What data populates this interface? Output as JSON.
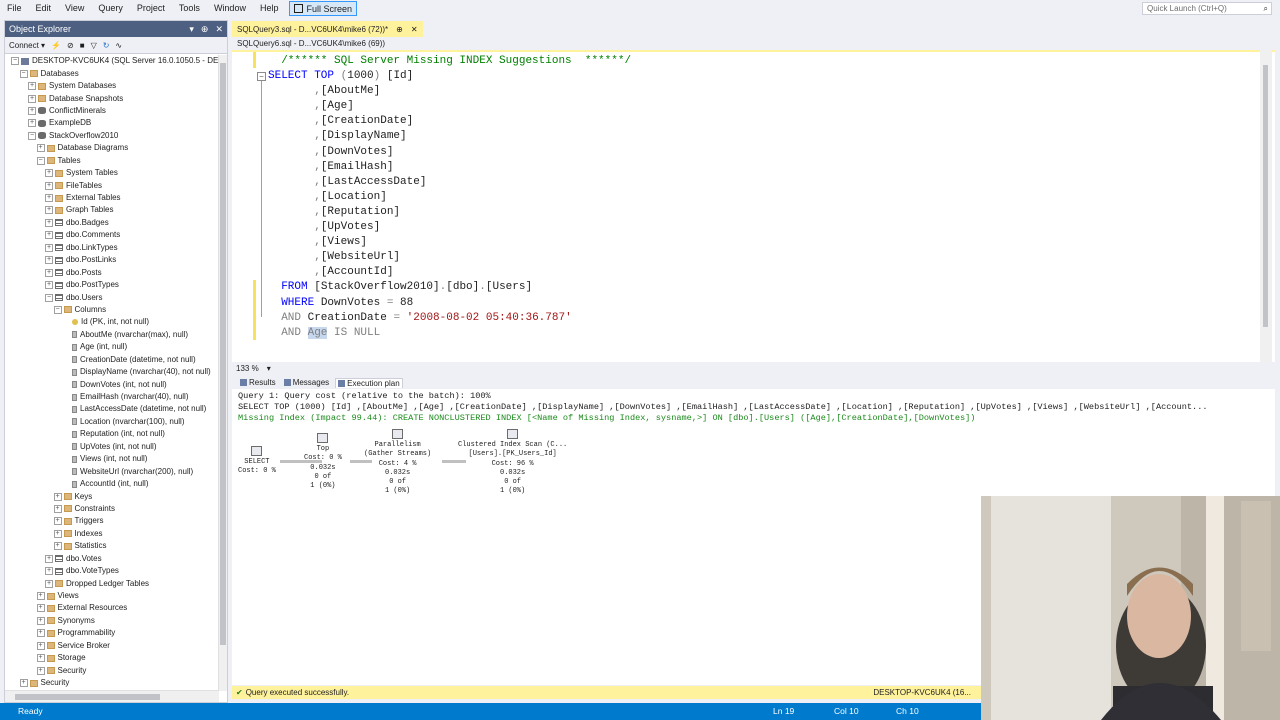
{
  "menubar": {
    "items": [
      "File",
      "Edit",
      "View",
      "Query",
      "Project",
      "Tools",
      "Window",
      "Help"
    ],
    "fullscreen_label": "Full Screen",
    "quick_launch_placeholder": "Quick Launch (Ctrl+Q)"
  },
  "object_explorer": {
    "title": "Object Explorer",
    "connect_label": "Connect ▾",
    "tree": [
      {
        "label": "DESKTOP-KVC6UK4 (SQL Server 16.0.1050.5 - DESKTO",
        "indent": 0,
        "expander": "−",
        "icon": "server"
      },
      {
        "label": "Databases",
        "indent": 1,
        "expander": "−",
        "icon": "folder"
      },
      {
        "label": "System Databases",
        "indent": 2,
        "expander": "+",
        "icon": "folder"
      },
      {
        "label": "Database Snapshots",
        "indent": 2,
        "expander": "+",
        "icon": "folder"
      },
      {
        "label": "ConflictMinerals",
        "indent": 2,
        "expander": "+",
        "icon": "db"
      },
      {
        "label": "ExampleDB",
        "indent": 2,
        "expander": "+",
        "icon": "db"
      },
      {
        "label": "StackOverflow2010",
        "indent": 2,
        "expander": "−",
        "icon": "db"
      },
      {
        "label": "Database Diagrams",
        "indent": 3,
        "expander": "+",
        "icon": "folder"
      },
      {
        "label": "Tables",
        "indent": 3,
        "expander": "−",
        "icon": "folder"
      },
      {
        "label": "System Tables",
        "indent": 4,
        "expander": "+",
        "icon": "folder"
      },
      {
        "label": "FileTables",
        "indent": 4,
        "expander": "+",
        "icon": "folder"
      },
      {
        "label": "External Tables",
        "indent": 4,
        "expander": "+",
        "icon": "folder"
      },
      {
        "label": "Graph Tables",
        "indent": 4,
        "expander": "+",
        "icon": "folder"
      },
      {
        "label": "dbo.Badges",
        "indent": 4,
        "expander": "+",
        "icon": "table"
      },
      {
        "label": "dbo.Comments",
        "indent": 4,
        "expander": "+",
        "icon": "table"
      },
      {
        "label": "dbo.LinkTypes",
        "indent": 4,
        "expander": "+",
        "icon": "table"
      },
      {
        "label": "dbo.PostLinks",
        "indent": 4,
        "expander": "+",
        "icon": "table"
      },
      {
        "label": "dbo.Posts",
        "indent": 4,
        "expander": "+",
        "icon": "table"
      },
      {
        "label": "dbo.PostTypes",
        "indent": 4,
        "expander": "+",
        "icon": "table"
      },
      {
        "label": "dbo.Users",
        "indent": 4,
        "expander": "−",
        "icon": "table"
      },
      {
        "label": "Columns",
        "indent": 5,
        "expander": "−",
        "icon": "folder"
      },
      {
        "label": "Id (PK, int, not null)",
        "indent": 6,
        "expander": "",
        "icon": "key"
      },
      {
        "label": "AboutMe (nvarchar(max), null)",
        "indent": 6,
        "expander": "",
        "icon": "col"
      },
      {
        "label": "Age (int, null)",
        "indent": 6,
        "expander": "",
        "icon": "col"
      },
      {
        "label": "CreationDate (datetime, not null)",
        "indent": 6,
        "expander": "",
        "icon": "col"
      },
      {
        "label": "DisplayName (nvarchar(40), not null)",
        "indent": 6,
        "expander": "",
        "icon": "col"
      },
      {
        "label": "DownVotes (int, not null)",
        "indent": 6,
        "expander": "",
        "icon": "col"
      },
      {
        "label": "EmailHash (nvarchar(40), null)",
        "indent": 6,
        "expander": "",
        "icon": "col"
      },
      {
        "label": "LastAccessDate (datetime, not null)",
        "indent": 6,
        "expander": "",
        "icon": "col"
      },
      {
        "label": "Location (nvarchar(100), null)",
        "indent": 6,
        "expander": "",
        "icon": "col"
      },
      {
        "label": "Reputation (int, not null)",
        "indent": 6,
        "expander": "",
        "icon": "col"
      },
      {
        "label": "UpVotes (int, not null)",
        "indent": 6,
        "expander": "",
        "icon": "col"
      },
      {
        "label": "Views (int, not null)",
        "indent": 6,
        "expander": "",
        "icon": "col"
      },
      {
        "label": "WebsiteUrl (nvarchar(200), null)",
        "indent": 6,
        "expander": "",
        "icon": "col"
      },
      {
        "label": "AccountId (int, null)",
        "indent": 6,
        "expander": "",
        "icon": "col"
      },
      {
        "label": "Keys",
        "indent": 5,
        "expander": "+",
        "icon": "folder"
      },
      {
        "label": "Constraints",
        "indent": 5,
        "expander": "+",
        "icon": "folder"
      },
      {
        "label": "Triggers",
        "indent": 5,
        "expander": "+",
        "icon": "folder"
      },
      {
        "label": "Indexes",
        "indent": 5,
        "expander": "+",
        "icon": "folder"
      },
      {
        "label": "Statistics",
        "indent": 5,
        "expander": "+",
        "icon": "folder"
      },
      {
        "label": "dbo.Votes",
        "indent": 4,
        "expander": "+",
        "icon": "table"
      },
      {
        "label": "dbo.VoteTypes",
        "indent": 4,
        "expander": "+",
        "icon": "table"
      },
      {
        "label": "Dropped Ledger Tables",
        "indent": 4,
        "expander": "+",
        "icon": "folder"
      },
      {
        "label": "Views",
        "indent": 3,
        "expander": "+",
        "icon": "folder"
      },
      {
        "label": "External Resources",
        "indent": 3,
        "expander": "+",
        "icon": "folder"
      },
      {
        "label": "Synonyms",
        "indent": 3,
        "expander": "+",
        "icon": "folder"
      },
      {
        "label": "Programmability",
        "indent": 3,
        "expander": "+",
        "icon": "folder"
      },
      {
        "label": "Service Broker",
        "indent": 3,
        "expander": "+",
        "icon": "folder"
      },
      {
        "label": "Storage",
        "indent": 3,
        "expander": "+",
        "icon": "folder"
      },
      {
        "label": "Security",
        "indent": 3,
        "expander": "+",
        "icon": "folder"
      },
      {
        "label": "Security",
        "indent": 1,
        "expander": "+",
        "icon": "folder"
      }
    ]
  },
  "tabs": {
    "active": "SQLQuery3.sql - D...VC6UK4\\mike6 (72))*",
    "active_pin": "⊕",
    "active_close": "✕",
    "second": "SQLQuery6.sql - D...VC6UK4\\mike6 (69))"
  },
  "editor": {
    "lines": [
      [
        {
          "t": "  /****** SQL Server Missing INDEX Suggestions  ******/",
          "c": "cm"
        }
      ],
      [
        {
          "t": "SELECT TOP ",
          "c": "kw"
        },
        {
          "t": "(",
          "c": "gr"
        },
        {
          "t": "1000",
          "c": ""
        },
        {
          "t": ")",
          "c": "gr"
        },
        {
          "t": " [Id]",
          "c": ""
        }
      ],
      [
        {
          "t": "       ,",
          "c": "gr"
        },
        {
          "t": "[AboutMe]",
          "c": ""
        }
      ],
      [
        {
          "t": "       ,",
          "c": "gr"
        },
        {
          "t": "[Age]",
          "c": ""
        }
      ],
      [
        {
          "t": "       ,",
          "c": "gr"
        },
        {
          "t": "[CreationDate]",
          "c": ""
        }
      ],
      [
        {
          "t": "       ,",
          "c": "gr"
        },
        {
          "t": "[DisplayName]",
          "c": ""
        }
      ],
      [
        {
          "t": "       ,",
          "c": "gr"
        },
        {
          "t": "[DownVotes]",
          "c": ""
        }
      ],
      [
        {
          "t": "       ,",
          "c": "gr"
        },
        {
          "t": "[EmailHash]",
          "c": ""
        }
      ],
      [
        {
          "t": "       ,",
          "c": "gr"
        },
        {
          "t": "[LastAccessDate]",
          "c": ""
        }
      ],
      [
        {
          "t": "       ,",
          "c": "gr"
        },
        {
          "t": "[Location]",
          "c": ""
        }
      ],
      [
        {
          "t": "       ,",
          "c": "gr"
        },
        {
          "t": "[Reputation]",
          "c": ""
        }
      ],
      [
        {
          "t": "       ,",
          "c": "gr"
        },
        {
          "t": "[UpVotes]",
          "c": ""
        }
      ],
      [
        {
          "t": "       ,",
          "c": "gr"
        },
        {
          "t": "[Views]",
          "c": ""
        }
      ],
      [
        {
          "t": "       ,",
          "c": "gr"
        },
        {
          "t": "[WebsiteUrl]",
          "c": ""
        }
      ],
      [
        {
          "t": "       ,",
          "c": "gr"
        },
        {
          "t": "[AccountId]",
          "c": ""
        }
      ],
      [
        {
          "t": "  FROM ",
          "c": "kw"
        },
        {
          "t": "[StackOverflow2010]",
          "c": ""
        },
        {
          "t": ".",
          "c": "gr"
        },
        {
          "t": "[dbo]",
          "c": ""
        },
        {
          "t": ".",
          "c": "gr"
        },
        {
          "t": "[Users]",
          "c": ""
        }
      ],
      [
        {
          "t": "  WHERE ",
          "c": "kw"
        },
        {
          "t": "DownVotes ",
          "c": ""
        },
        {
          "t": "=",
          "c": "gr"
        },
        {
          "t": " 88",
          "c": ""
        }
      ],
      [
        {
          "t": "  AND ",
          "c": "gr"
        },
        {
          "t": "CreationDate ",
          "c": ""
        },
        {
          "t": "=",
          "c": "gr"
        },
        {
          "t": " '2008-08-02 05:40:36.787'",
          "c": "st"
        }
      ],
      [
        {
          "t": "  AND ",
          "c": "gr"
        },
        {
          "t": "Age",
          "c": "gr hl"
        },
        {
          "t": " IS NULL",
          "c": "gr"
        }
      ]
    ],
    "zoom": "133 %",
    "zoom_caret": "▾"
  },
  "results": {
    "tabs": [
      "Results",
      "Messages",
      "Execution plan"
    ],
    "query_cost": "Query 1: Query cost (relative to the batch): 100%",
    "query_text": "SELECT TOP (1000) [Id] ,[AboutMe] ,[Age] ,[CreationDate] ,[DisplayName] ,[DownVotes] ,[EmailHash] ,[LastAccessDate] ,[Location] ,[Reputation] ,[UpVotes] ,[Views] ,[WebsiteUrl] ,[Account...",
    "missing_index": "Missing Index (Impact 99.44): CREATE NONCLUSTERED INDEX [<Name of Missing Index, sysname,>] ON [dbo].[Users] ([Age],[CreationDate],[DownVotes])",
    "operators": [
      {
        "lines": [
          "SELECT",
          "Cost: 0 %"
        ]
      },
      {
        "lines": [
          "Top",
          "Cost: 0 %",
          "0.032s",
          "0 of",
          "1 (0%)"
        ]
      },
      {
        "lines": [
          "Parallelism",
          "(Gather Streams)",
          "Cost: 4 %",
          "0.032s",
          "0 of",
          "1 (0%)"
        ]
      },
      {
        "lines": [
          "Clustered Index Scan (C...",
          "[Users].[PK_Users_Id]",
          "Cost: 96 %",
          "0.032s",
          "0 of",
          "1 (0%)"
        ]
      }
    ]
  },
  "status": {
    "message": "Query executed successfully.",
    "server": "DESKTOP-KVC6UK4 (16..."
  },
  "statusbar": {
    "ready": "Ready",
    "ln": "Ln 19",
    "col": "Col 10",
    "ch": "Ch 10"
  },
  "colors": {
    "accent": "#007acc",
    "tab_active": "#fff29d",
    "oe_title": "#4d6082"
  }
}
